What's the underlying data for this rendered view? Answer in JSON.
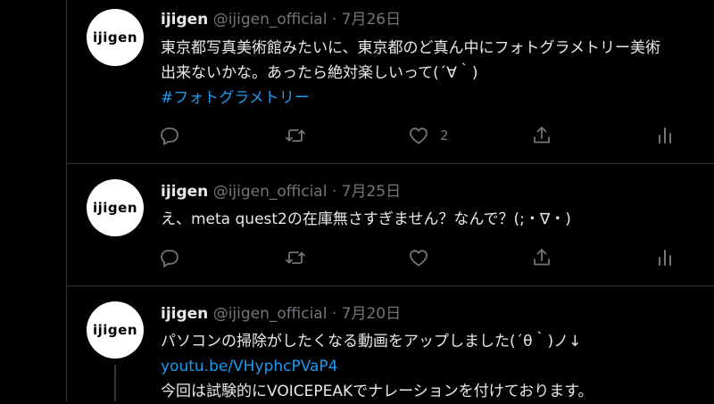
{
  "tweets": [
    {
      "avatar_text": "ijigen",
      "name": "ijigen",
      "handle": "@ijigen_official",
      "separator": "·",
      "date": "7月26日",
      "lines": [
        "東京都写真美術館みたいに、東京都のど真ん中にフォトグラメトリー美術",
        "出来ないかな。あったら絶対楽しいって(´∀｀)"
      ],
      "hashtag": "#フォトグラメトリー",
      "like_count": "2"
    },
    {
      "avatar_text": "ijigen",
      "name": "ijigen",
      "handle": "@ijigen_official",
      "separator": "·",
      "date": "7月25日",
      "lines": [
        "え、meta quest2の在庫無さすぎません？なんで？(;・∇・)"
      ]
    },
    {
      "avatar_text": "ijigen",
      "name": "ijigen",
      "handle": "@ijigen_official",
      "separator": "·",
      "date": "7月20日",
      "lines": [
        "パソコンの掃除がしたくなる動画をアップしました(´θ｀)ノ↓"
      ],
      "link": "youtu.be/VHyphcPVaP4",
      "lines_after": [
        "今回は試験的にVOICEPEAKでナレーションを付けております。"
      ]
    }
  ],
  "icons": {
    "reply": "reply-icon",
    "retweet": "retweet-icon",
    "like": "like-icon",
    "share": "share-icon",
    "analytics": "analytics-icon"
  },
  "colors": {
    "background": "#000000",
    "text": "#e7e9ea",
    "muted": "#71767b",
    "link": "#1d9bf0",
    "border": "#2f3336"
  }
}
